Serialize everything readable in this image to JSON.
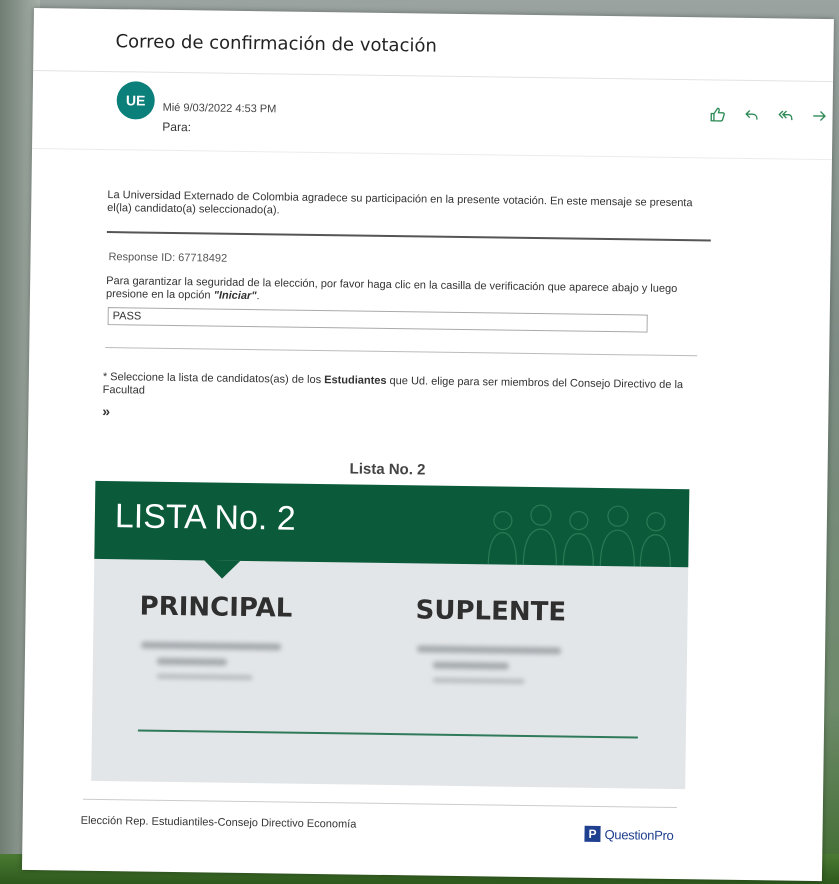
{
  "email": {
    "subject": "Correo de confirmación de votación",
    "avatar_initials": "UE",
    "date": "Mié 9/03/2022 4:53 PM",
    "to_label": "Para:",
    "actions": [
      {
        "name": "like-icon"
      },
      {
        "name": "reply-icon"
      },
      {
        "name": "reply-all-icon"
      },
      {
        "name": "forward-icon"
      }
    ]
  },
  "body": {
    "intro": "La Universidad Externado de Colombia agradece su participación en la presente votación. En este mensaje se presenta el(la) candidato(a) seleccionado(a).",
    "response_id": "Response ID: 67718492",
    "security_text_a": "Para garantizar la seguridad de la elección, por favor haga clic en la casilla de verificación que aparece abajo y luego presione en la opción ",
    "security_em": "\"Iniciar\"",
    "security_text_b": ".",
    "pass_value": "PASS",
    "select_a": "* Seleccione la lista de candidatos(as) de los ",
    "select_b": "Estudiantes",
    "select_c": " que Ud. elige para ser miembros del Consejo Directivo de la Facultad",
    "arrow": "»",
    "lista_title": "Lista No. 2"
  },
  "banner": {
    "label": "LISTA No. 2",
    "principal": "PRINCIPAL",
    "suplente": "SUPLENTE"
  },
  "footer": {
    "text": "Elección Rep. Estudiantiles-Consejo Directivo Economía",
    "brand_letter": "P",
    "brand_name": "QuestionPro"
  },
  "colors": {
    "avatar": "#0b7f7a",
    "banner": "#0b5a3a",
    "action_icons": "#2e8b57",
    "brand": "#1f3f8f"
  }
}
